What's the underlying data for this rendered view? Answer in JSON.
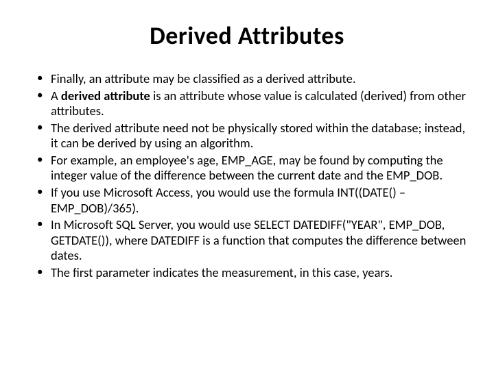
{
  "title": "Derived Attributes",
  "bullets": [
    {
      "pre": "Finally, an attribute may be classified as a derived attribute.",
      "bold": "",
      "post": ""
    },
    {
      "pre": "A ",
      "bold": "derived attribute",
      "post": " is an attribute whose value is calculated (derived) from other attributes."
    },
    {
      "pre": "The derived attribute need not be physically stored within the database; instead, it can be derived by using an algorithm.",
      "bold": "",
      "post": ""
    },
    {
      "pre": "For example, an employee's age, EMP_AGE, may be found by computing the integer value of the difference between the current date and the EMP_DOB.",
      "bold": "",
      "post": ""
    },
    {
      "pre": "If you use Microsoft Access, you would use the formula INT((DATE() – EMP_DOB)/365).",
      "bold": "",
      "post": ""
    },
    {
      "pre": "In Microsoft SQL Server, you would use SELECT DATEDIFF(\"YEAR\", EMP_DOB, GETDATE()), where DATEDIFF is a function that computes the difference between dates.",
      "bold": "",
      "post": ""
    },
    {
      "pre": "The first parameter indicates the measurement, in this case, years.",
      "bold": "",
      "post": ""
    }
  ]
}
